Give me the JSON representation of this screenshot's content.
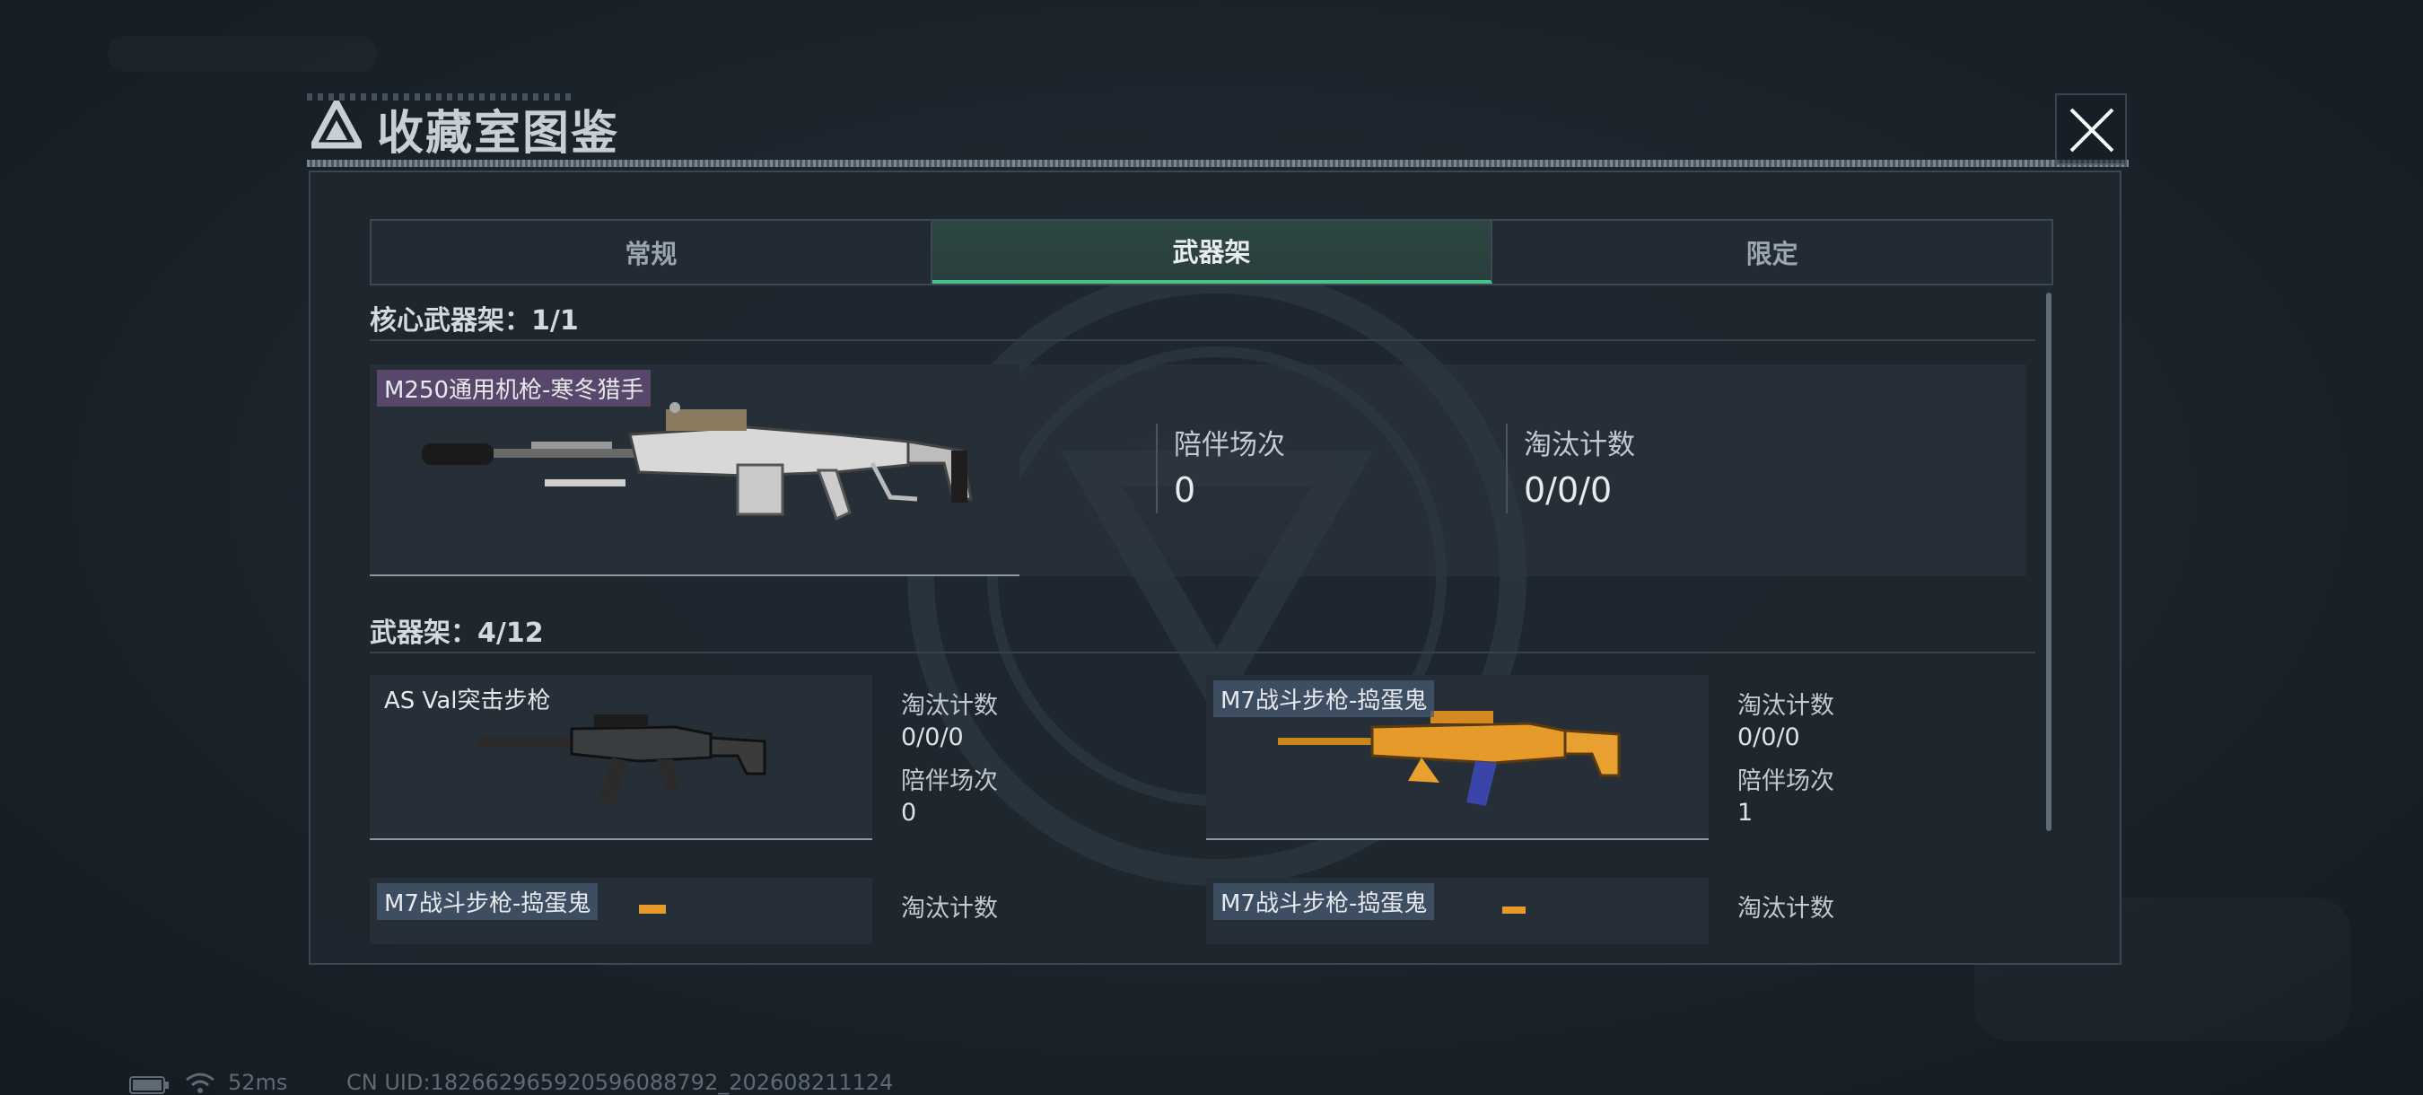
{
  "title": "收藏室图鉴",
  "tabs": [
    "常规",
    "武器架",
    "限定"
  ],
  "active_tab": "武器架",
  "core_section": {
    "title": "核心武器架：1/1"
  },
  "core_item": {
    "name": "M250通用机枪-寒冬猎手",
    "stats": [
      {
        "label": "陪伴场次",
        "value": "0"
      },
      {
        "label": "淘汰计数",
        "value": "0/0/0"
      }
    ]
  },
  "rack_section": {
    "title": "武器架：4/12"
  },
  "rack_items": [
    {
      "name": "AS Val突击步枪",
      "elim_label": "淘汰计数",
      "elim_value": "0/0/0",
      "match_label": "陪伴场次",
      "match_value": "0"
    },
    {
      "name": "M7战斗步枪-捣蛋鬼",
      "elim_label": "淘汰计数",
      "elim_value": "0/0/0",
      "match_label": "陪伴场次",
      "match_value": "1"
    },
    {
      "name": "M7战斗步枪-捣蛋鬼",
      "elim_label": "淘汰计数"
    },
    {
      "name": "M7战斗步枪-捣蛋鬼",
      "elim_label": "淘汰计数"
    }
  ],
  "footer": {
    "ping": "52ms",
    "uid": "CN UID:18266296592059608879​2_202608211124"
  },
  "colors": {
    "accent": "#45c489",
    "name_tag_purple": "#69507d",
    "name_tag_blue": "#465a73"
  },
  "icons": [
    "logo-icon",
    "close-icon",
    "battery-icon",
    "wifi-icon"
  ]
}
